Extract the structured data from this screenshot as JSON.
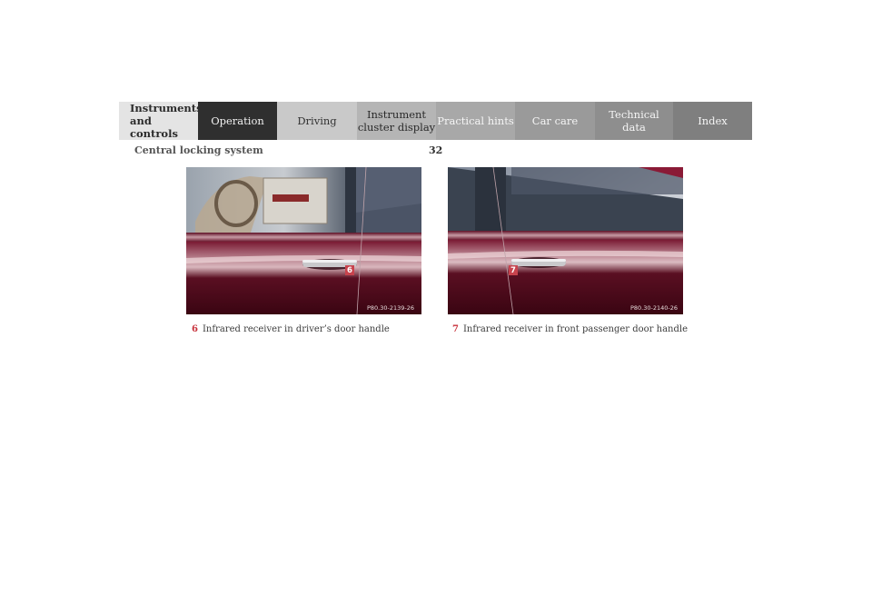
{
  "nav": {
    "tabs": [
      {
        "label": "Instruments\nand controls"
      },
      {
        "label": "Operation"
      },
      {
        "label": "Driving"
      },
      {
        "label": "Instrument\ncluster display"
      },
      {
        "label": "Practical hints"
      },
      {
        "label": "Car care"
      },
      {
        "label": "Technical\ndata"
      },
      {
        "label": "Index"
      }
    ]
  },
  "header": {
    "section_title": "Central locking system",
    "page_number": "32"
  },
  "figures": [
    {
      "code": "P80.30-2139-26",
      "callout": "6",
      "caption": "Infrared receiver in driver’s door handle"
    },
    {
      "code": "P80.30-2140-26",
      "callout": "7",
      "caption": "Infrared receiver in front passenger door handle"
    }
  ],
  "colors": {
    "callout_red": "#c7434d",
    "active_tab": "#2f2f2f",
    "car_paint": "#5a0f22"
  }
}
